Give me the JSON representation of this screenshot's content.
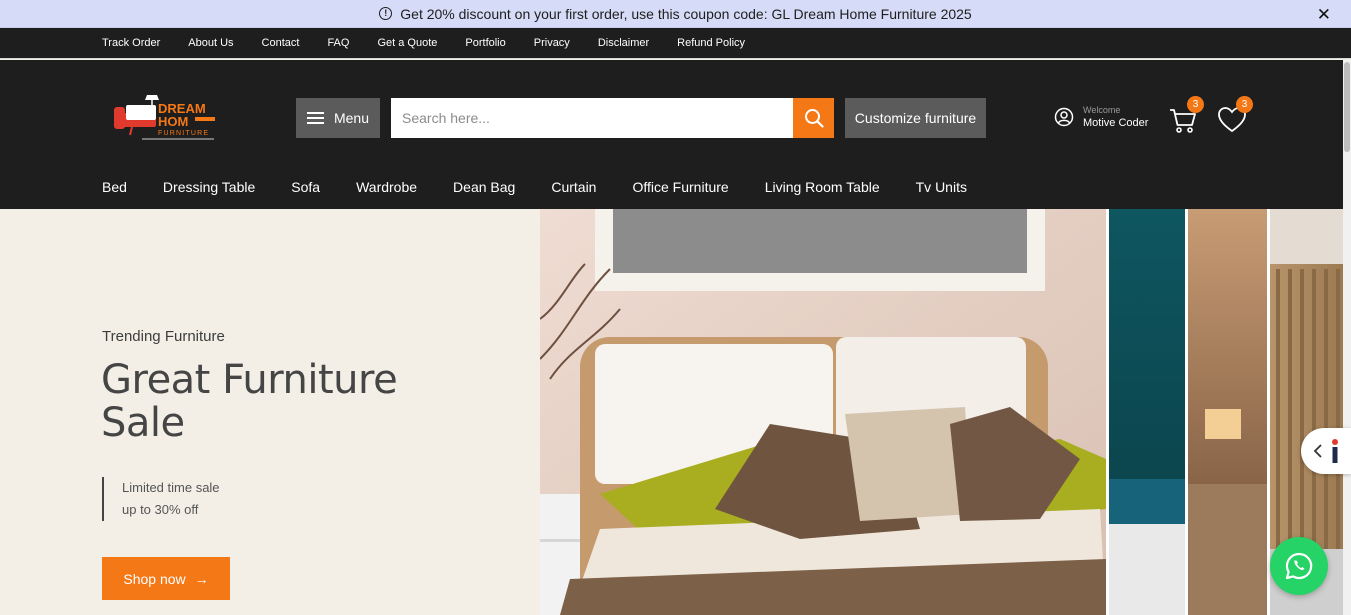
{
  "announcement": {
    "text": "Get 20% discount on your first order, use this coupon code: GL Dream Home Furniture  2025",
    "close_label": "✕"
  },
  "top_links": [
    "Track Order",
    "About Us",
    "Contact",
    "FAQ",
    "Get a Quote",
    "Portfolio",
    "Privacy",
    "Disclaimer",
    "Refund Policy"
  ],
  "header": {
    "logo": {
      "line1": "DREAM",
      "line2": "HOM",
      "line3": "FURNITURE"
    },
    "menu_label": "Menu",
    "search_placeholder": "Search here...",
    "customize_label": "Customize furniture",
    "user": {
      "welcome": "Welcome",
      "name": "Motive Coder"
    },
    "cart_count": "3",
    "wishlist_count": "3"
  },
  "categories": [
    "Bed",
    "Dressing Table",
    "Sofa",
    "Wardrobe",
    "Dean Bag",
    "Curtain",
    "Office Furniture",
    "Living Room Table",
    "Tv Units"
  ],
  "hero": {
    "eyebrow": "Trending Furniture",
    "headline": "Great Furniture Sale",
    "offer_line1": "Limited time sale",
    "offer_line2": "up to 30% off",
    "cta_label": "Shop now",
    "cta_arrow": "→"
  },
  "colors": {
    "accent": "#f57817",
    "dark": "#1e1e1e",
    "announce_bg": "#d6dcf7",
    "hero_bg": "#f3efe6",
    "whatsapp": "#25d366"
  },
  "icons": [
    "info-icon",
    "close-icon",
    "menu-icon",
    "search-icon",
    "user-icon",
    "cart-icon",
    "heart-icon",
    "arrow-right-icon",
    "chevron-left-icon",
    "info-letter-icon",
    "whatsapp-icon"
  ]
}
